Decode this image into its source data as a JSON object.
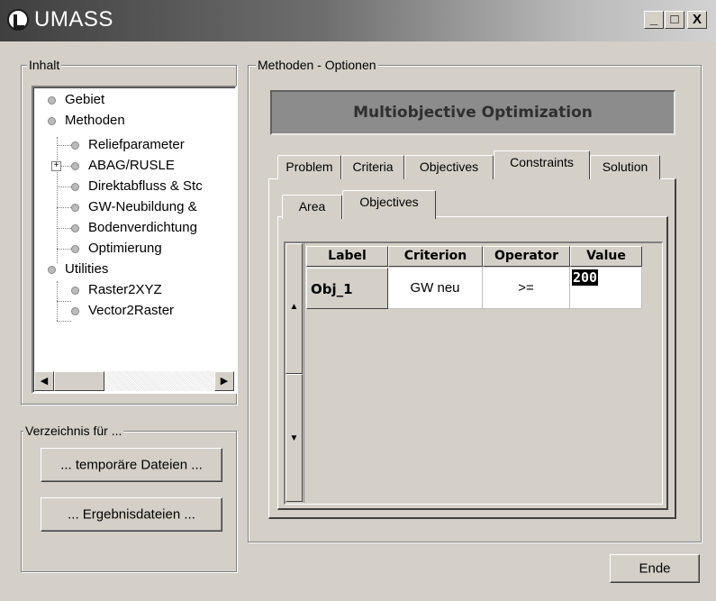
{
  "window": {
    "title": "UMASS",
    "minimize_glyph": "_",
    "maximize_glyph": "□",
    "close_glyph": "X"
  },
  "inhalt": {
    "label": "Inhalt",
    "tree": [
      {
        "label": "Gebiet"
      },
      {
        "label": "Methoden"
      },
      {
        "label": "Reliefparameter"
      },
      {
        "label": "ABAG/RUSLE"
      },
      {
        "label": "Direktabfluss & Stc"
      },
      {
        "label": "GW-Neubildung &"
      },
      {
        "label": "Bodenverdichtung"
      },
      {
        "label": "Optimierung"
      },
      {
        "label": "Utilities"
      },
      {
        "label": "Raster2XYZ"
      },
      {
        "label": "Vector2Raster"
      }
    ],
    "expander_glyph": "+"
  },
  "verzeichnis": {
    "label": "Verzeichnis für ...",
    "temp_button": "... temporäre Dateien ...",
    "result_button": "... Ergebnisdateien ..."
  },
  "methoden": {
    "label": "Methoden - Optionen",
    "banner": "Multiobjective Optimization",
    "tabs": [
      "Problem",
      "Criteria",
      "Objectives",
      "Constraints",
      "Solution"
    ],
    "active_tab": "Constraints",
    "subtabs": [
      "Area",
      "Objectives"
    ],
    "active_subtab": "Objectives",
    "grid": {
      "headers": [
        "Label",
        "Criterion",
        "Operator",
        "Value"
      ],
      "rows": [
        {
          "label": "Obj_1",
          "criterion": "GW neu",
          "operator": ">=",
          "value": "200"
        }
      ]
    }
  },
  "footer": {
    "ende_button": "Ende"
  }
}
